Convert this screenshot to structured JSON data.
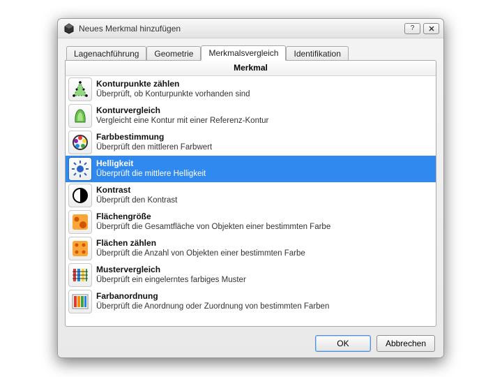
{
  "window": {
    "title": "Neues Merkmal hinzufügen"
  },
  "tabs": {
    "t0": "Lagenachführung",
    "t1": "Geometrie",
    "t2": "Merkmalsvergleich",
    "t3": "Identifikation",
    "activeIndex": 2
  },
  "panel": {
    "column_header": "Merkmal",
    "items": [
      {
        "name": "Konturpunkte zählen",
        "desc": "Überprüft, ob Konturpunkte vorhanden sind",
        "icon": "contour-points",
        "selected": false
      },
      {
        "name": "Konturvergleich",
        "desc": "Vergleicht eine Kontur mit einer Referenz-Kontur",
        "icon": "contour-compare",
        "selected": false
      },
      {
        "name": "Farbbestimmung",
        "desc": "Überprüft den mittleren Farbwert",
        "icon": "color-detect",
        "selected": false
      },
      {
        "name": "Helligkeit",
        "desc": "Überprüft die mittlere Helligkeit",
        "icon": "brightness",
        "selected": true
      },
      {
        "name": "Kontrast",
        "desc": "Überprüft den Kontrast",
        "icon": "contrast",
        "selected": false
      },
      {
        "name": "Flächengröße",
        "desc": "Überprüft die Gesamtfläche von Objekten einer bestimmten Farbe",
        "icon": "area-size",
        "selected": false
      },
      {
        "name": "Flächen zählen",
        "desc": "Überprüft die Anzahl von Objekten einer bestimmten Farbe",
        "icon": "area-count",
        "selected": false
      },
      {
        "name": "Mustervergleich",
        "desc": "Überprüft ein eingelerntes farbiges Muster",
        "icon": "pattern-compare",
        "selected": false
      },
      {
        "name": "Farbanordnung",
        "desc": "Überprüft die Anordnung oder Zuordnung von bestimmten Farben",
        "icon": "color-arrangement",
        "selected": false
      }
    ]
  },
  "buttons": {
    "ok": "OK",
    "cancel": "Abbrechen"
  }
}
